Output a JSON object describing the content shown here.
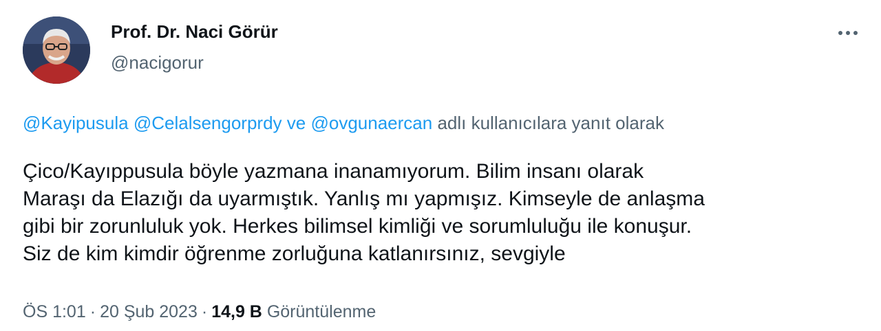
{
  "author": {
    "name": "Prof. Dr. Naci Görür",
    "handle": "@nacigorur",
    "avatar_icon": "profile-photo"
  },
  "more_icon": "more-horizontal-icon",
  "reply_context": {
    "mention_1": "@Kayipusula",
    "mention_2": "@Celalsengorprdy",
    "conjunction": "ve",
    "mention_3": "@ovgunaercan",
    "suffix": "adlı kullanıcılara yanıt olarak"
  },
  "tweet": {
    "text": "Çico/Kayıppusula böyle yazmana inanamıyorum. Bilim insanı olarak\nMaraşı da Elazığı da uyarmıştık. Yanlış mı yapmışız. Kimseyle de anlaşma\ngibi bir zorunluluk yok. Herkes bilimsel kimliği ve sorumluluğu ile konuşur.\nSiz de kim kimdir öğrenme zorluğuna katlanırsınız, sevgiyle"
  },
  "meta": {
    "time": "ÖS 1:01",
    "separator_1": "·",
    "date": "20 Şub 2023",
    "separator_2": "·",
    "views_count": "14,9 B",
    "views_label": "Görüntülenme"
  },
  "colors": {
    "link": "#1d9bf0",
    "secondary_text": "#536471",
    "primary_text": "#0f1419"
  }
}
